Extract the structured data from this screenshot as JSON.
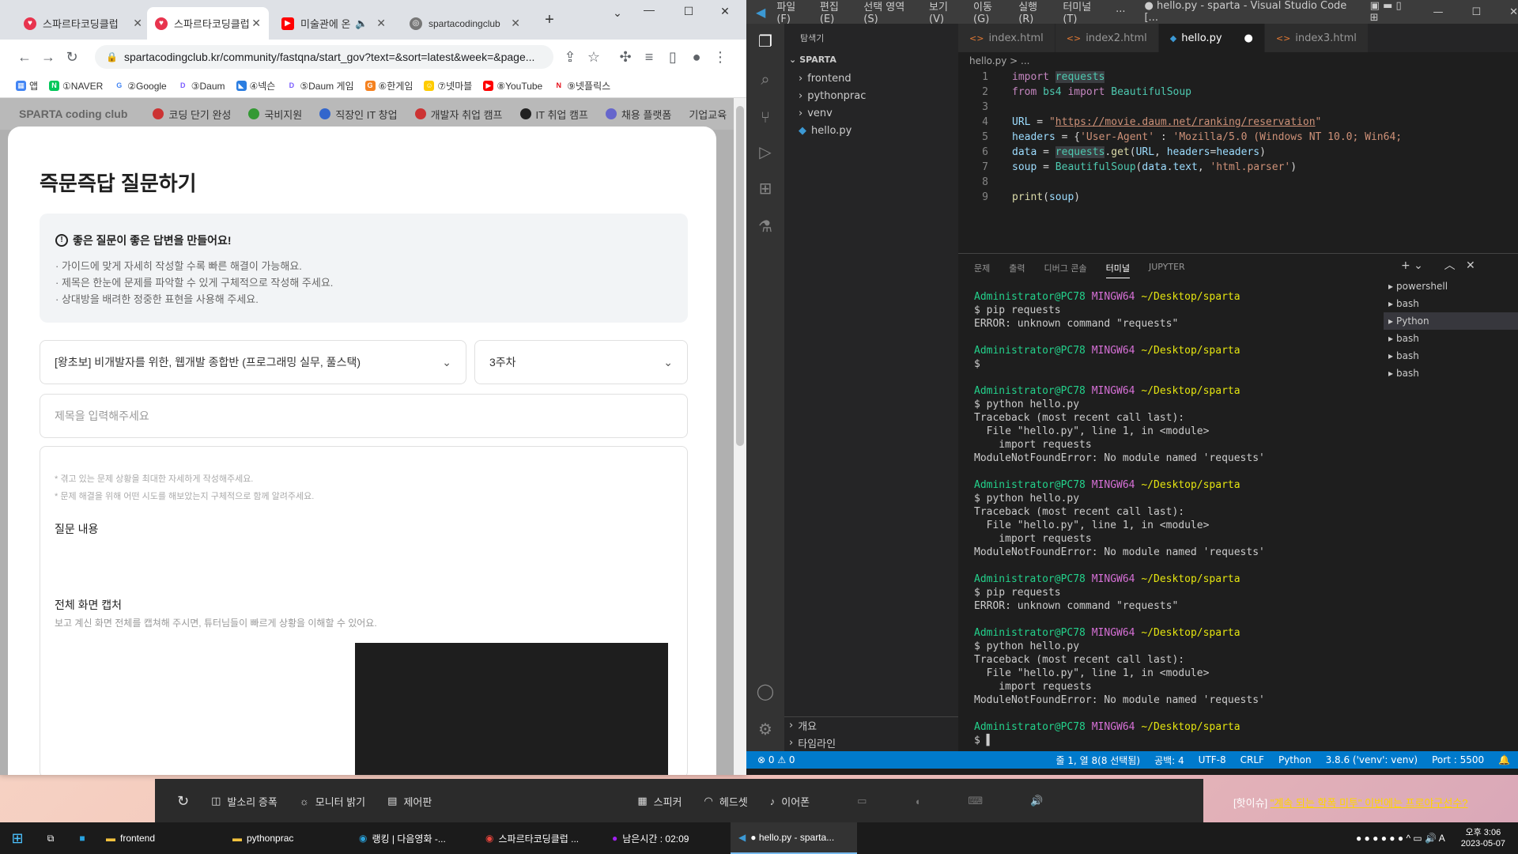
{
  "chrome": {
    "tabs": [
      {
        "label": "스파르타코딩클럽",
        "active": false
      },
      {
        "label": "스파르타코딩클럽",
        "active": true
      },
      {
        "label": "미술관에 온",
        "active": false
      },
      {
        "label": "spartacodingclub",
        "active": false
      }
    ],
    "url": "spartacodingclub.kr/community/fastqna/start_gov?text=&sort=latest&week=&page...",
    "bookmarks": [
      "앱",
      "①NAVER",
      "②Google",
      "③Daum",
      "④넥슨",
      "⑤Daum 게임",
      "⑥한게임",
      "⑦넷마블",
      "⑧YouTube",
      "⑨넷플릭스"
    ],
    "nav": [
      "코딩 단기 완성",
      "국비지원",
      "직장인 IT 창업",
      "개발자 취업 캠프",
      "IT 취업 캠프",
      "채용 플랫폼",
      "기업교육"
    ],
    "logo": "SPARTA coding club"
  },
  "modal": {
    "title": "즉문즉답 질문하기",
    "guide_title": "좋은 질문이 좋은 답변을 만들어요!",
    "guide_lines": [
      "· 가이드에 맞게 자세히 작성할 수록 빠른 해결이 가능해요.",
      "· 제목은 한눈에 문제를 파악할 수 있게 구체적으로 작성해 주세요.",
      "· 상대방을 배려한 정중한 표현을 사용해 주세요."
    ],
    "course_select": "[왕초보] 비개발자를 위한, 웹개발 종합반 (프로그래밍 실무, 풀스택)",
    "week_select": "3주차",
    "title_placeholder": "제목을 입력해주세요",
    "hint1": "* 겪고 있는 문제 상황을 최대한 자세하게 작성해주세요.",
    "hint2": "* 문제 해결을 위해 어떤 시도를 해보았는지 구체적으로 함께 알려주세요.",
    "question_label": "질문 내용",
    "capture_label": "전체 화면 캡처",
    "capture_desc": "보고 계신 화면 전체를 캡쳐해 주시면, 튜터님들이 빠르게 상황을 이해할 수 있어요."
  },
  "vscode": {
    "menus": [
      "파일(F)",
      "편집(E)",
      "선택 영역(S)",
      "보기(V)",
      "이동(G)",
      "실행(R)",
      "터미널(T)",
      "···"
    ],
    "window_title": "● hello.py - sparta - Visual Studio Code [...",
    "explorer_title": "탐색기",
    "root": "SPARTA",
    "tree": [
      "frontend",
      "pythonprac",
      "venv",
      "hello.py"
    ],
    "outline": "개요",
    "timeline": "타임라인",
    "tabs": [
      "index.html",
      "index2.html",
      "hello.py",
      "index3.html"
    ],
    "breadcrumb": "hello.py > ...",
    "panel_tabs": [
      "문제",
      "출력",
      "디버그 콘솔",
      "터미널",
      "JUPYTER"
    ],
    "terminals": [
      "powershell",
      "bash",
      "Python",
      "bash",
      "bash",
      "bash"
    ],
    "prompt_user": "Administrator@PC78",
    "prompt_env": "MINGW64",
    "prompt_path": "~/Desktop/sparta",
    "status": {
      "errors": "⊗ 0 ⚠ 0",
      "pos": "줄 1, 열 8(8 선택됨)",
      "spaces": "공백: 4",
      "enc": "UTF-8",
      "eol": "CRLF",
      "lang": "Python",
      "interp": "3.8.6 ('venv': venv)",
      "port": "Port : 5500"
    }
  },
  "floatbar": [
    "발소리 증폭",
    "모니터 밝기",
    "제어판",
    "스피커",
    "헤드셋",
    "이어폰"
  ],
  "taskbar": {
    "items": [
      "frontend",
      "pythonprac",
      "랭킹 | 다음영화 -...",
      "스파르타코딩클럽 ...",
      "남은시간 : 02:09",
      "● hello.py - sparta..."
    ],
    "time": "오후 3:06",
    "date": "2023-05-07"
  },
  "news": {
    "tag": "[핫이슈]",
    "text": "\"계속 되는 학폭 미투\" 이번에는 프로야구선수?"
  }
}
